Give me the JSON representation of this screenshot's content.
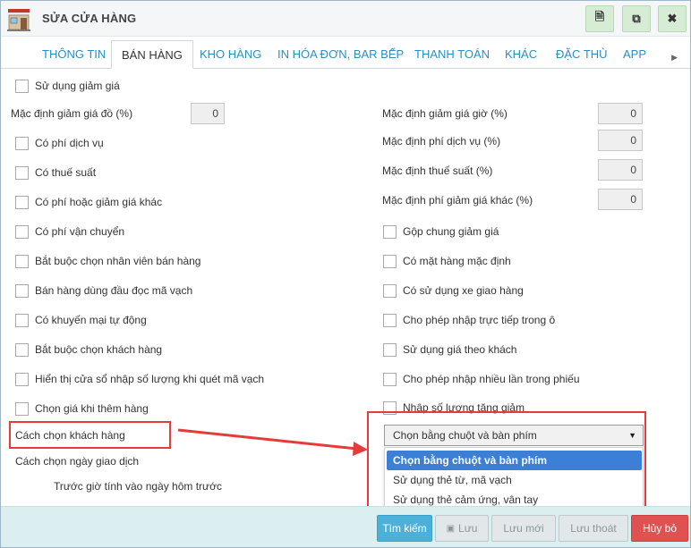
{
  "window": {
    "title": "SỬA CỬA HÀNG",
    "buttons": [
      {
        "name": "document",
        "glyph": "🗎"
      },
      {
        "name": "copy",
        "glyph": "⧉"
      },
      {
        "name": "close",
        "glyph": "✖"
      }
    ]
  },
  "tabs": [
    {
      "label": "THÔNG TIN",
      "active": false
    },
    {
      "label": "BÁN HÀNG",
      "active": true
    },
    {
      "label": "KHO HÀNG",
      "active": false
    },
    {
      "label": "IN HÓA ĐƠN, BAR BẾP",
      "active": false
    },
    {
      "label": "THANH TOÁN",
      "active": false
    },
    {
      "label": "KHÁC",
      "active": false
    },
    {
      "label": "ĐẶC THÙ",
      "active": false
    },
    {
      "label": "APP",
      "active": false
    }
  ],
  "tab_scroll_glyph": "▶",
  "left": {
    "use_discount": "Sử dụng giảm giá",
    "default_discount_label": "Mặc định giảm giá đồ (%)",
    "default_discount_value": "0",
    "checkboxes": [
      "Có phí dịch vụ",
      "Có thuế suất",
      "Có phí hoặc giảm giá khác",
      "Có phí vận chuyển",
      "Bắt buộc chọn nhân viên bán hàng",
      "Bán hàng dùng đầu đọc mã vạch",
      "Có khuyến mại tự động",
      "Bắt buộc chọn khách hàng",
      "Hiển thị cửa sổ nhập số lượng khi quét mã vạch",
      "Chọn giá khi thêm hàng"
    ],
    "customer_select_label": "Cách chọn khách hàng",
    "delivery_date_label": "Cách chọn ngày giao dịch",
    "before_hour_label": "Trước giờ tính vào ngày hôm trước"
  },
  "right": {
    "fields": [
      {
        "label": "Mặc định giảm giá giờ (%)",
        "value": "0"
      },
      {
        "label": "Mặc định phí dịch vụ (%)",
        "value": "0"
      },
      {
        "label": "Mặc định thuế suất (%)",
        "value": "0"
      },
      {
        "label": "Mặc định phí giảm giá khác (%)",
        "value": "0"
      }
    ],
    "checkboxes": [
      "Gộp chung giảm giá",
      "Có mặt hàng mặc định",
      "Có sử dụng xe giao hàng",
      "Cho phép nhập trực tiếp trong ô",
      "Sử dụng giá theo khách",
      "Cho phép nhập nhiều lần trong phiếu",
      "Nhập số lượng tăng giảm"
    ]
  },
  "customer_select": {
    "selected": "Chọn bằng chuột và bàn phím",
    "options": [
      "Chọn bằng chuột và bàn phím",
      "Sử dụng thẻ từ, mã vạch",
      "Sử dụng thẻ cảm ứng, vân tay"
    ],
    "caret": "▼"
  },
  "footer": {
    "search": "Tìm kiếm",
    "save": "Lưu",
    "save_new": "Lưu mới",
    "save_exit": "Lưu thoát",
    "cancel": "Hủy bỏ"
  },
  "colors": {
    "tab_link": "#2a8fbf",
    "highlight": "#e53b3b",
    "option_selected": "#3c7fd6",
    "footer_bg": "#dbeff1",
    "primary": "#4bb1d9",
    "danger": "#e05252"
  }
}
